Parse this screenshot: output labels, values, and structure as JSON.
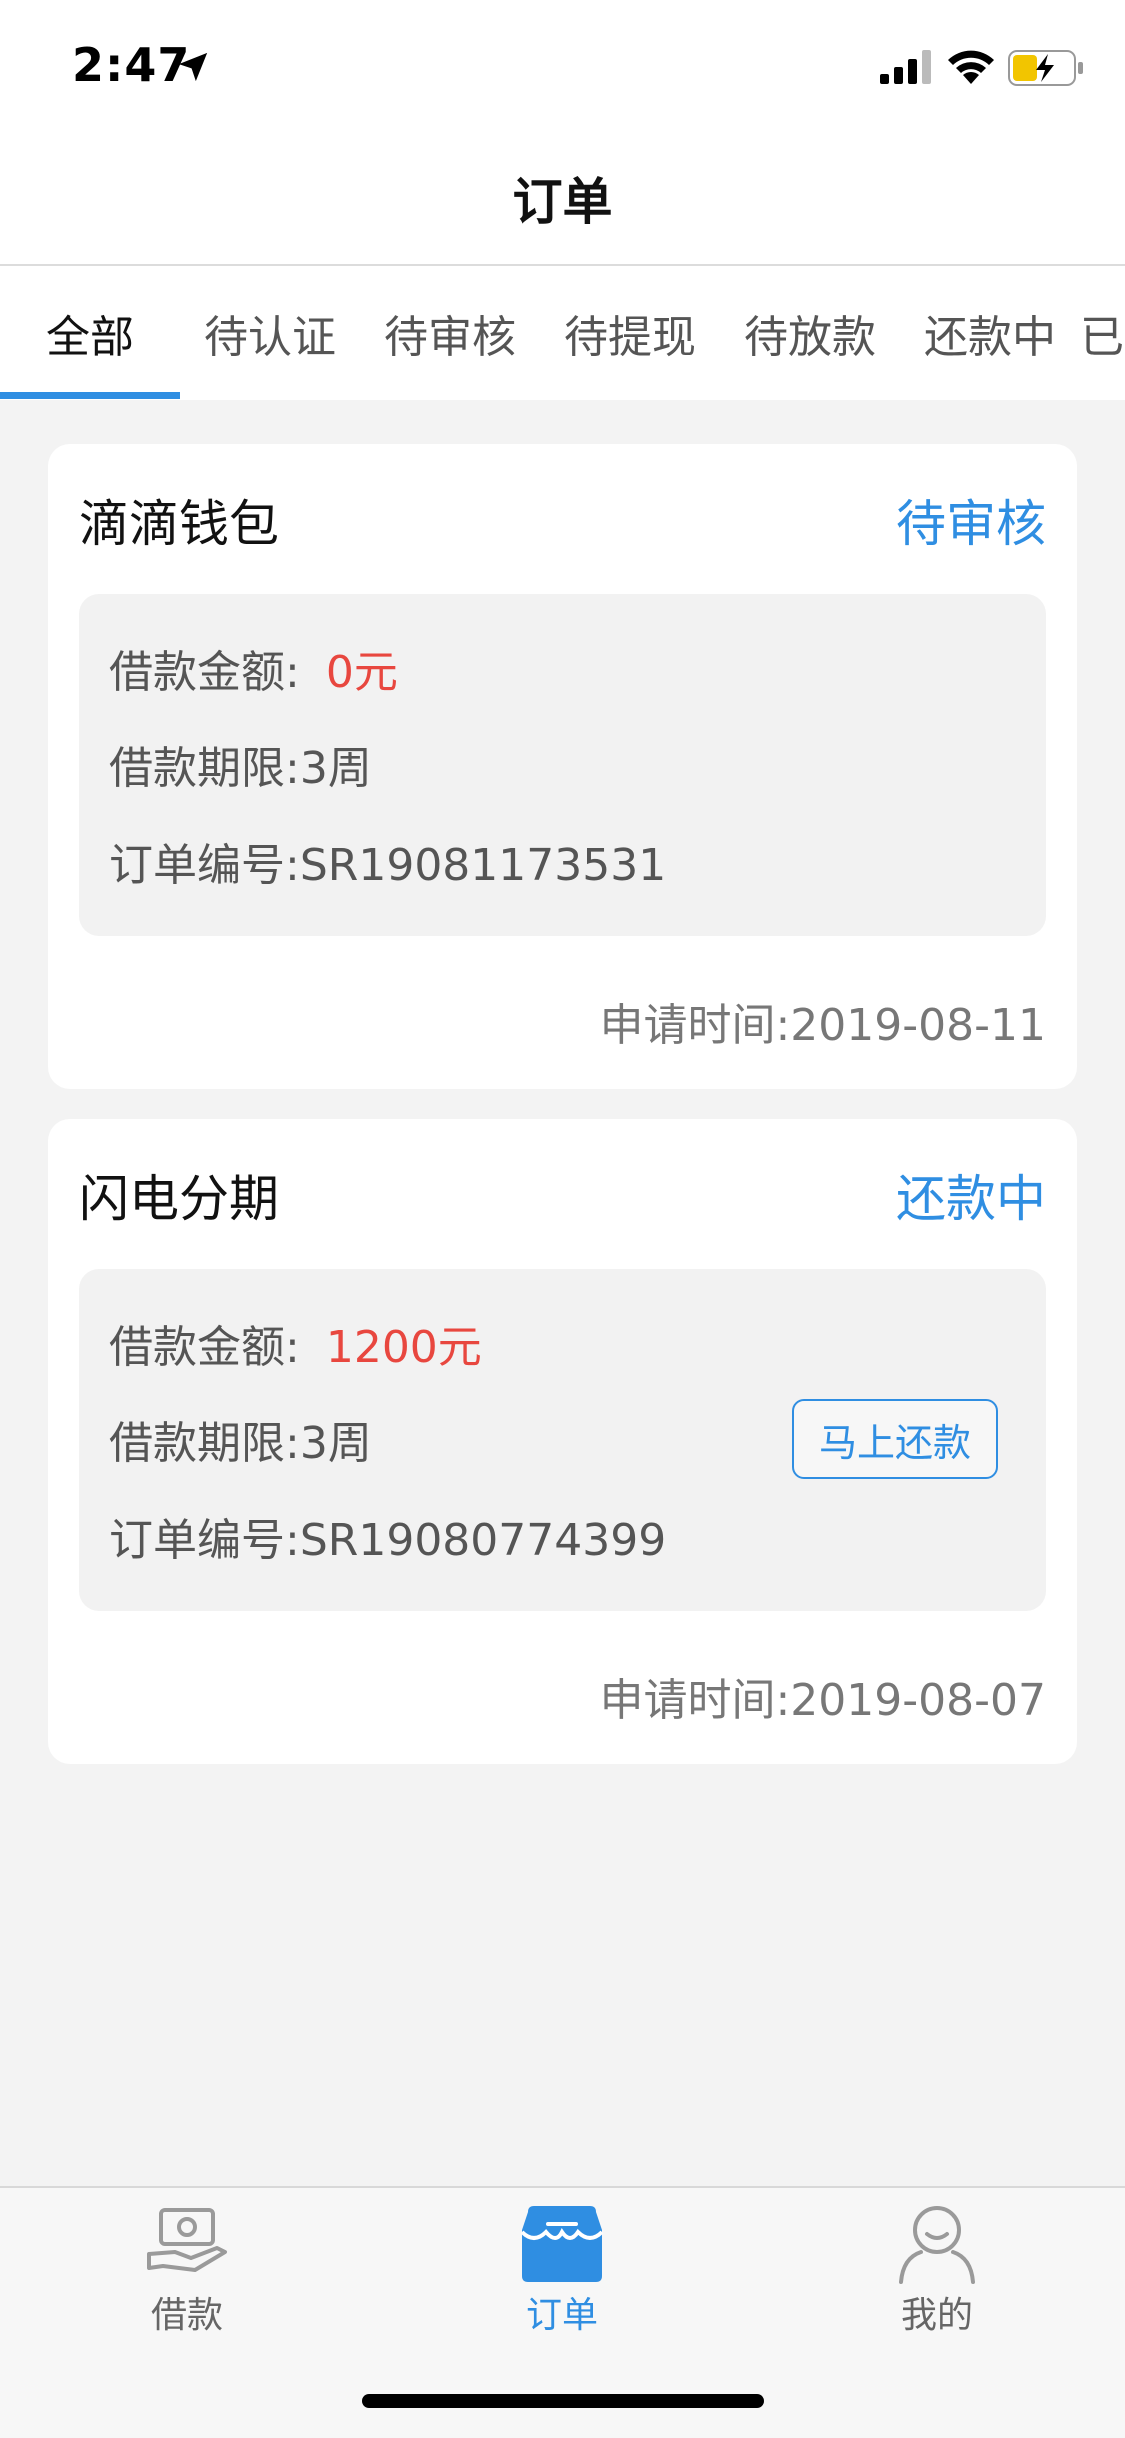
{
  "status_bar": {
    "time": "2:47",
    "icons": [
      "location-arrow-icon",
      "cellular-signal-icon",
      "wifi-icon",
      "battery-charging-icon"
    ]
  },
  "nav": {
    "title": "订单"
  },
  "tabs": [
    {
      "label": "全部",
      "active": true
    },
    {
      "label": "待认证",
      "active": false
    },
    {
      "label": "待审核",
      "active": false
    },
    {
      "label": "待提现",
      "active": false
    },
    {
      "label": "待放款",
      "active": false
    },
    {
      "label": "还款中",
      "active": false
    },
    {
      "label": "已",
      "active": false
    }
  ],
  "orders": [
    {
      "name": "滴滴钱包",
      "status": "待审核",
      "amount_label": "借款金额:",
      "amount_value": "0元",
      "term": "借款期限:3周",
      "order_no": "订单编号:SR19081173531",
      "apply_time": "申请时间:2019-08-11"
    },
    {
      "name": "闪电分期",
      "status": "还款中",
      "amount_label": "借款金额:",
      "amount_value": "1200元",
      "term": "借款期限:3周",
      "order_no": "订单编号:SR19080774399",
      "apply_time": "申请时间:2019-08-07",
      "action_label": "马上还款"
    }
  ],
  "tab_bar": [
    {
      "label": "借款",
      "icon": "loan-icon",
      "active": false
    },
    {
      "label": "订单",
      "icon": "order-store-icon",
      "active": true
    },
    {
      "label": "我的",
      "icon": "profile-icon",
      "active": false
    }
  ],
  "colors": {
    "accent": "#2f8ee2",
    "amount": "#e8473f",
    "background": "#f3f3f3"
  }
}
